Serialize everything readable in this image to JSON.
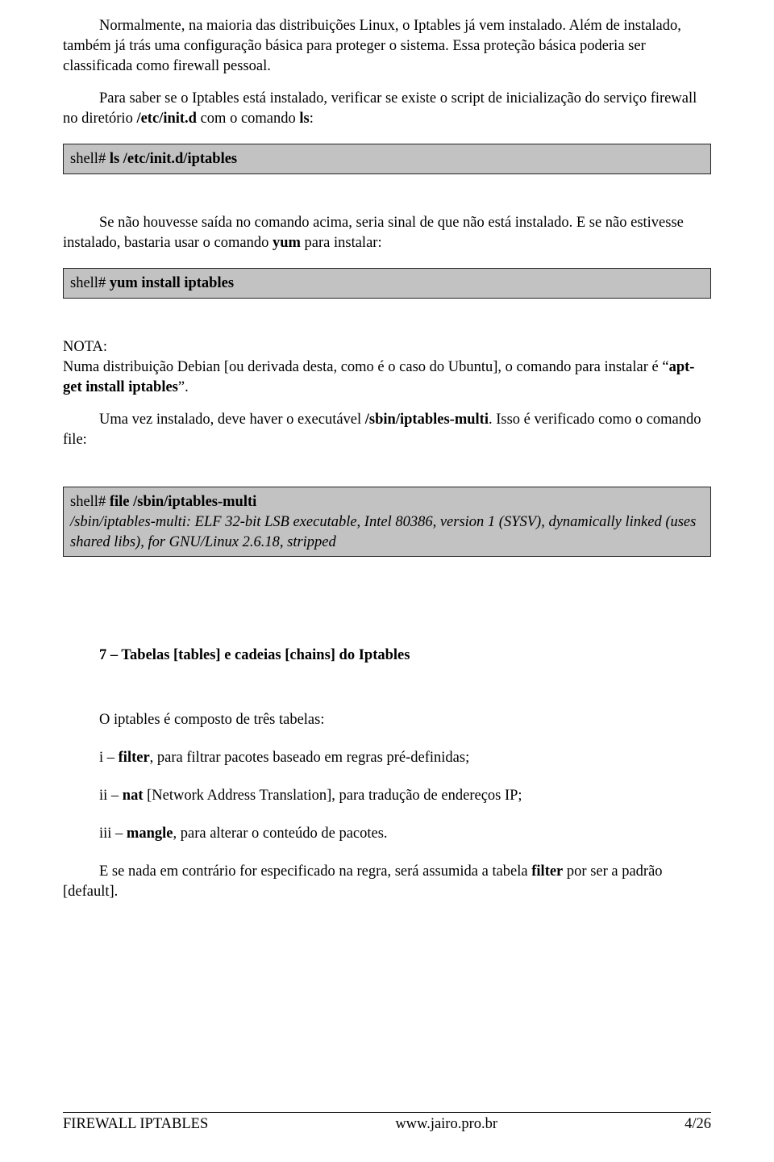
{
  "p1": "Normalmente, na maioria das distribuições Linux, o Iptables já vem instalado. Além de instalado, também já trás uma configuração básica para proteger o sistema. Essa proteção básica poderia ser classificada como firewall pessoal.",
  "p2_a": "Para saber se o Iptables está instalado, verificar se existe o script de inicialização do serviço firewall no diretório  ",
  "p2_b1": "/etc/init.d",
  "p2_c": "  com o comando  ",
  "p2_b2": "ls",
  "p2_d": ":",
  "cb1_prompt": "shell# ",
  "cb1_cmd": "ls  /etc/init.d/iptables",
  "p3_a": "Se não houvesse saída no comando acima, seria sinal de que não está instalado. E se não estivesse instalado, bastaria usar o comando  ",
  "p3_b": "yum",
  "p3_c": "  para instalar:",
  "cb2_prompt": "shell# ",
  "cb2_cmd": "yum  install  iptables",
  "nota_label": "NOTA:",
  "nota_text_a": "Numa distribuição Debian [ou derivada desta, como é o caso do Ubuntu], o comando para instalar é “",
  "nota_text_b": "apt-get  install  iptables",
  "nota_text_c": "”.",
  "p4_a": "Uma vez instalado, deve haver o executável  ",
  "p4_b": "/sbin/iptables-multi",
  "p4_c": ". Isso é verificado como o comando file:",
  "cb3_prompt": "shell# ",
  "cb3_cmd": "file  /sbin/iptables-multi",
  "cb3_out1": "/sbin/iptables-multi: ELF 32-bit LSB executable, Intel 80386, version 1 (SYSV), dynamically linked (uses shared libs), for GNU/Linux 2.6.18, stripped",
  "section_title": "7 – Tabelas [tables] e cadeias [chains] do Iptables",
  "intro_tables": "O iptables é composto de três tabelas:",
  "li1_a": "i – ",
  "li1_b": "filter",
  "li1_c": ", para filtrar pacotes baseado em regras pré-definidas;",
  "li2_a": "ii – ",
  "li2_b": "nat",
  "li2_c": " [Network Address Translation], para tradução de endereços IP;",
  "li3_a": "iii – ",
  "li3_b": "mangle",
  "li3_c": ", para alterar o conteúdo de pacotes.",
  "p5_a": "E se nada em contrário for especificado na regra, será assumida a tabela  ",
  "p5_b": "filter",
  "p5_c": "  por ser a padrão [default].",
  "footer_left": "FIREWALL IPTABLES",
  "footer_center": "www.jairo.pro.br",
  "footer_right": "4/26"
}
